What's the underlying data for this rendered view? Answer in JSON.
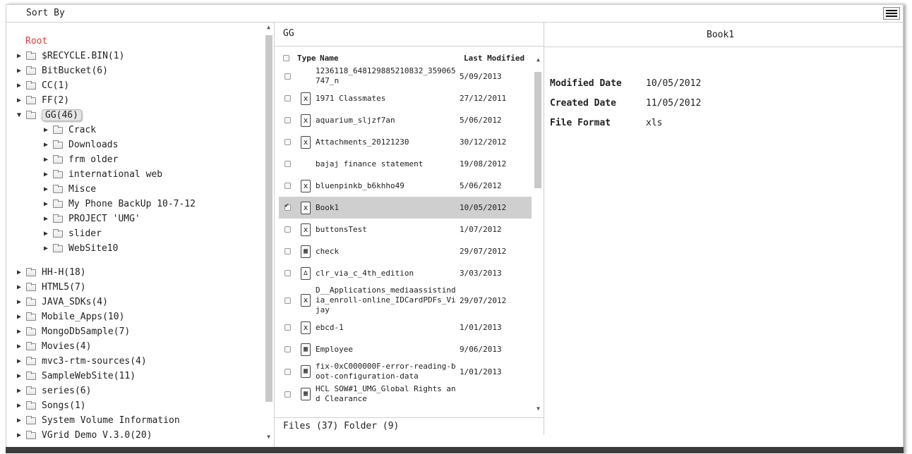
{
  "toolbar": {
    "sort_label": "Sort By",
    "menu_icon": "hamburger-icon"
  },
  "tree": {
    "root_label": "Root",
    "root_color": "#e03a3a",
    "items_before": [
      {
        "label": "$RECYCLE.BIN(1)"
      },
      {
        "label": "BitBucket(6)"
      },
      {
        "label": "CC(1)"
      },
      {
        "label": "FF(2)"
      }
    ],
    "selected": {
      "label": "GG(46)"
    },
    "children": [
      {
        "label": "Crack"
      },
      {
        "label": "Downloads"
      },
      {
        "label": "frm older"
      },
      {
        "label": "international web"
      },
      {
        "label": "Misce"
      },
      {
        "label": "My Phone BackUp 10-7-12"
      },
      {
        "label": "PROJECT 'UMG'"
      },
      {
        "label": "slider"
      },
      {
        "label": "WebSite10"
      }
    ],
    "items_after": [
      {
        "label": "HH-H(18)"
      },
      {
        "label": "HTML5(7)"
      },
      {
        "label": "JAVA_SDKs(4)"
      },
      {
        "label": "Mobile_Apps(10)"
      },
      {
        "label": "MongoDbSample(7)"
      },
      {
        "label": "Movies(4)"
      },
      {
        "label": "mvc3-rtm-sources(4)"
      },
      {
        "label": "SampleWebSite(11)"
      },
      {
        "label": "series(6)"
      },
      {
        "label": "Songs(1)"
      },
      {
        "label": "System Volume Information"
      },
      {
        "label": "VGrid Demo V.3.0(20)"
      }
    ]
  },
  "files": {
    "folder_title": "GG",
    "columns": {
      "type": "Type",
      "name": "Name",
      "modified": "Last Modified"
    },
    "rows": [
      {
        "icon": "",
        "name": "1236118_648129885210832_359065747_n",
        "modified": "5/09/2013",
        "checked": false
      },
      {
        "icon": "sheet",
        "name": "1971 Classmates",
        "modified": "27/12/2011",
        "checked": false
      },
      {
        "icon": "sheet",
        "name": "aquarium_sljzf7an",
        "modified": "5/06/2012",
        "checked": false
      },
      {
        "icon": "sheet",
        "name": "Attachments_20121230",
        "modified": "30/12/2012",
        "checked": false
      },
      {
        "icon": "",
        "name": "bajaj finance statement",
        "modified": "19/08/2012",
        "checked": false
      },
      {
        "icon": "sheet",
        "name": "bluenpinkb_b6khho49",
        "modified": "5/06/2012",
        "checked": false
      },
      {
        "icon": "sheet",
        "name": "Book1",
        "modified": "10/05/2012",
        "checked": true,
        "selected": true
      },
      {
        "icon": "sheet",
        "name": "buttonsTest",
        "modified": "1/07/2012",
        "checked": false
      },
      {
        "icon": "db",
        "name": "check",
        "modified": "29/07/2012",
        "checked": false
      },
      {
        "icon": "pdf",
        "name": "clr_via_c_4th_edition",
        "modified": "3/03/2013",
        "checked": false
      },
      {
        "icon": "sheet",
        "name": "D__Applications_mediaassistindia_enroll-online_IDCardPDFs_Vijay",
        "modified": "29/07/2012",
        "checked": false
      },
      {
        "icon": "sheet",
        "name": "ebcd-1",
        "modified": "1/01/2013",
        "checked": false
      },
      {
        "icon": "db",
        "name": "Employee",
        "modified": "9/06/2013",
        "checked": false
      },
      {
        "icon": "db",
        "name": "fix-0xC000000F-error-reading-boot-configuration-data",
        "modified": "1/01/2013",
        "checked": false
      },
      {
        "icon": "db",
        "name": "HCL SOW#1_UMG_Global Rights and Clearance",
        "modified": "",
        "checked": false
      }
    ],
    "footer": "Files (37) Folder (9)"
  },
  "detail": {
    "title": "Book1",
    "fields": [
      {
        "key": "Modified Date",
        "value": "10/05/2012"
      },
      {
        "key": "Created Date",
        "value": "11/05/2012"
      },
      {
        "key": "File Format",
        "value": "xls"
      }
    ]
  }
}
